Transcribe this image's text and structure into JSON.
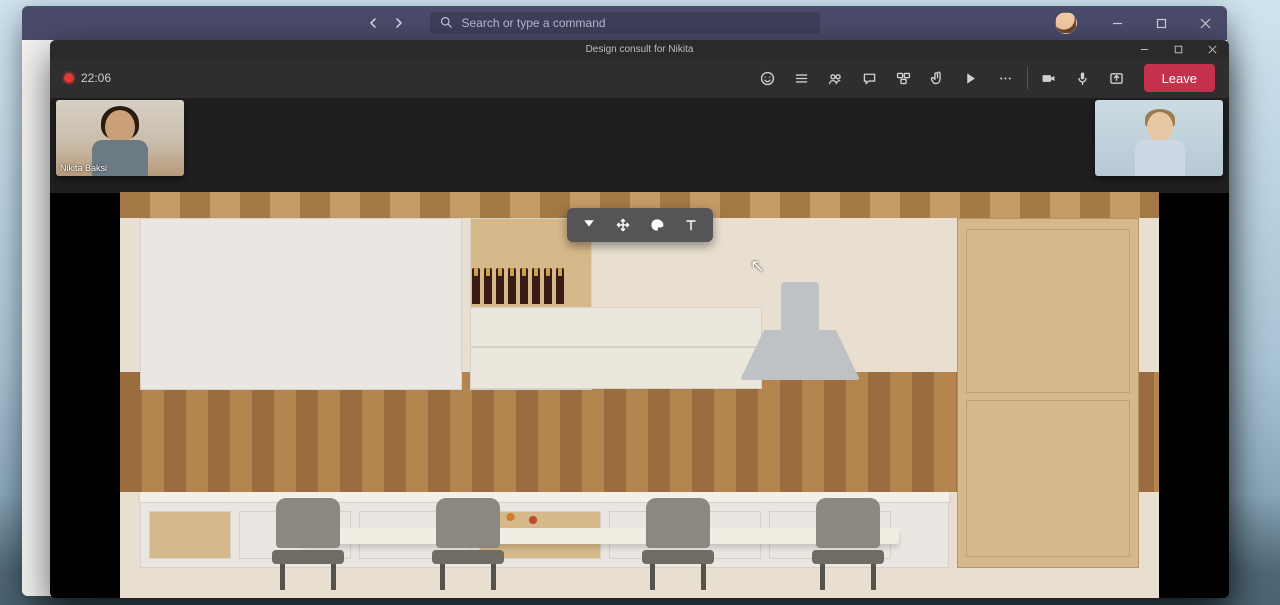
{
  "teams_titlebar": {
    "search_placeholder": "Search or type a command"
  },
  "meeting": {
    "title": "Design consult for Nikita",
    "recording_time": "22:06",
    "leave_label": "Leave",
    "participants": {
      "left_name": "Nikita Baksi"
    }
  },
  "toolbar_icons": {
    "reactions": "reactions",
    "view": "view",
    "people": "people",
    "chat": "chat",
    "rooms": "breakout-rooms",
    "raise_hand": "raise-hand",
    "apps": "apps",
    "more": "more",
    "camera": "camera",
    "mic": "mic",
    "share": "share"
  },
  "floating_toolbar": {
    "tool1": "highlighter",
    "tool2": "move",
    "tool3": "color",
    "tool4": "text"
  }
}
